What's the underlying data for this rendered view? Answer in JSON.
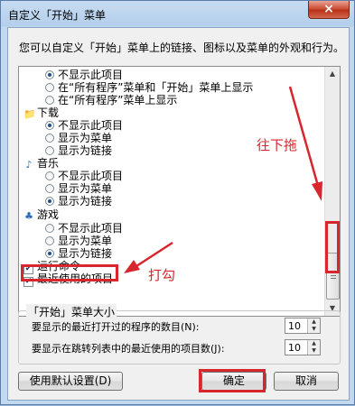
{
  "window": {
    "title": "自定义「开始」菜单",
    "close_icon": "×"
  },
  "intro_text": "您可以自定义「开始」菜单上的链接、图标以及菜单的外观和行为。",
  "list_items": [
    {
      "kind": "radio",
      "checked": true,
      "label": "不显示此项目"
    },
    {
      "kind": "radio",
      "checked": false,
      "label": "在“所有程序”菜单和「开始」菜单上显示"
    },
    {
      "kind": "radio",
      "checked": false,
      "label": "在“所有程序”菜单上显示"
    },
    {
      "kind": "category",
      "icon": "download-icon",
      "label": "下载"
    },
    {
      "kind": "radio",
      "checked": true,
      "label": "不显示此项目"
    },
    {
      "kind": "radio",
      "checked": false,
      "label": "显示为菜单"
    },
    {
      "kind": "radio",
      "checked": false,
      "label": "显示为链接"
    },
    {
      "kind": "category",
      "icon": "music-icon",
      "label": "音乐"
    },
    {
      "kind": "radio",
      "checked": false,
      "label": "不显示此项目"
    },
    {
      "kind": "radio",
      "checked": false,
      "label": "显示为菜单"
    },
    {
      "kind": "radio",
      "checked": true,
      "label": "显示为链接"
    },
    {
      "kind": "category",
      "icon": "games-icon",
      "label": "游戏"
    },
    {
      "kind": "radio",
      "checked": false,
      "label": "不显示此项目"
    },
    {
      "kind": "radio",
      "checked": false,
      "label": "显示为菜单"
    },
    {
      "kind": "radio",
      "checked": true,
      "label": "显示为链接"
    },
    {
      "kind": "check",
      "checked": true,
      "label": "运行命令"
    },
    {
      "kind": "check",
      "checked": true,
      "label": "最近使用的项目"
    }
  ],
  "menu_size": {
    "title": "「开始」菜单大小",
    "recent_programs_label": "要显示的最近打开过的程序的数目(N):",
    "recent_programs_value": "10",
    "jumplist_label": "要显示在跳转列表中的最近使用的项目数(J):",
    "jumplist_value": "10"
  },
  "buttons": {
    "defaults": "使用默认设置(D)",
    "ok": "确定",
    "cancel": "取消"
  },
  "annotations": {
    "drag_down": "往下拖",
    "check_it": "打勾"
  },
  "colors": {
    "annotation": "#d7262e"
  }
}
